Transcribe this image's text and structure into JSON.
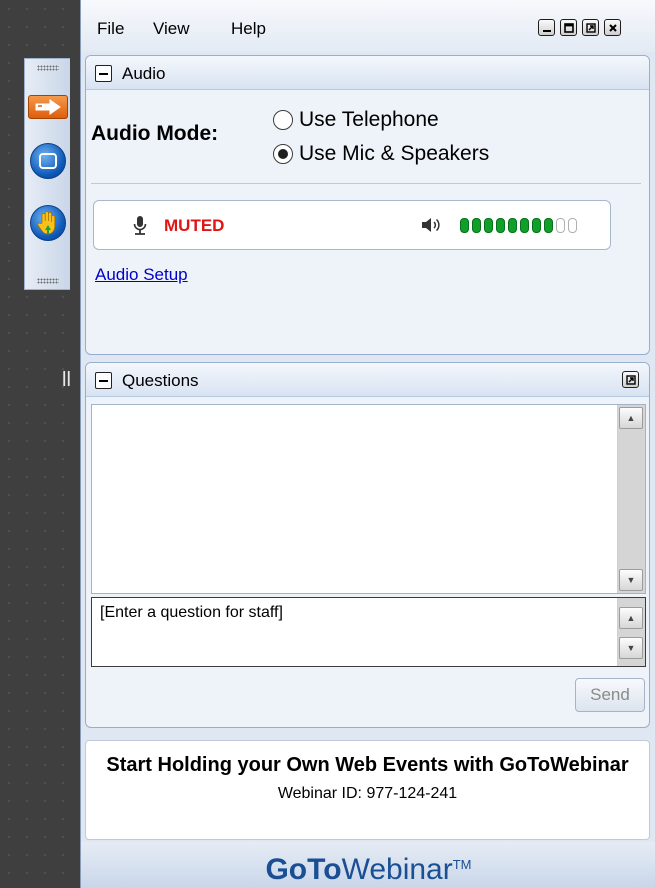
{
  "background": {
    "fragment_text": "ll"
  },
  "grab_tab": {
    "buttons": [
      {
        "icon": "arrow-right-icon"
      },
      {
        "icon": "screen-view-icon"
      },
      {
        "icon": "raise-hand-icon"
      }
    ]
  },
  "menu": {
    "file": "File",
    "view": "View",
    "help": "Help"
  },
  "window_controls": [
    "minimize-icon",
    "maximize-icon",
    "restore-icon",
    "close-icon"
  ],
  "audio": {
    "title": "Audio",
    "mode_label": "Audio Mode:",
    "options": [
      {
        "label": "Use Telephone",
        "selected": false
      },
      {
        "label": "Use Mic & Speakers",
        "selected": true
      }
    ],
    "mic_status": "MUTED",
    "speaker_level": 0.8,
    "audio_setup_link": "Audio Setup"
  },
  "questions": {
    "title": "Questions",
    "input_value": "[Enter a question for staff]",
    "send_label": "Send"
  },
  "promo": {
    "title": "Start Holding your Own Web Events with GoToWebinar",
    "webinar_id": "Webinar ID: 977-124-241"
  },
  "footer": {
    "brand_bold": "GoTo",
    "brand_light": "Webinar",
    "brand_tm": "TM"
  },
  "colors": {
    "muted": "#e01414",
    "link": "#0000cc",
    "brand": "#1b4f94",
    "level_on": "#0ea02a"
  }
}
